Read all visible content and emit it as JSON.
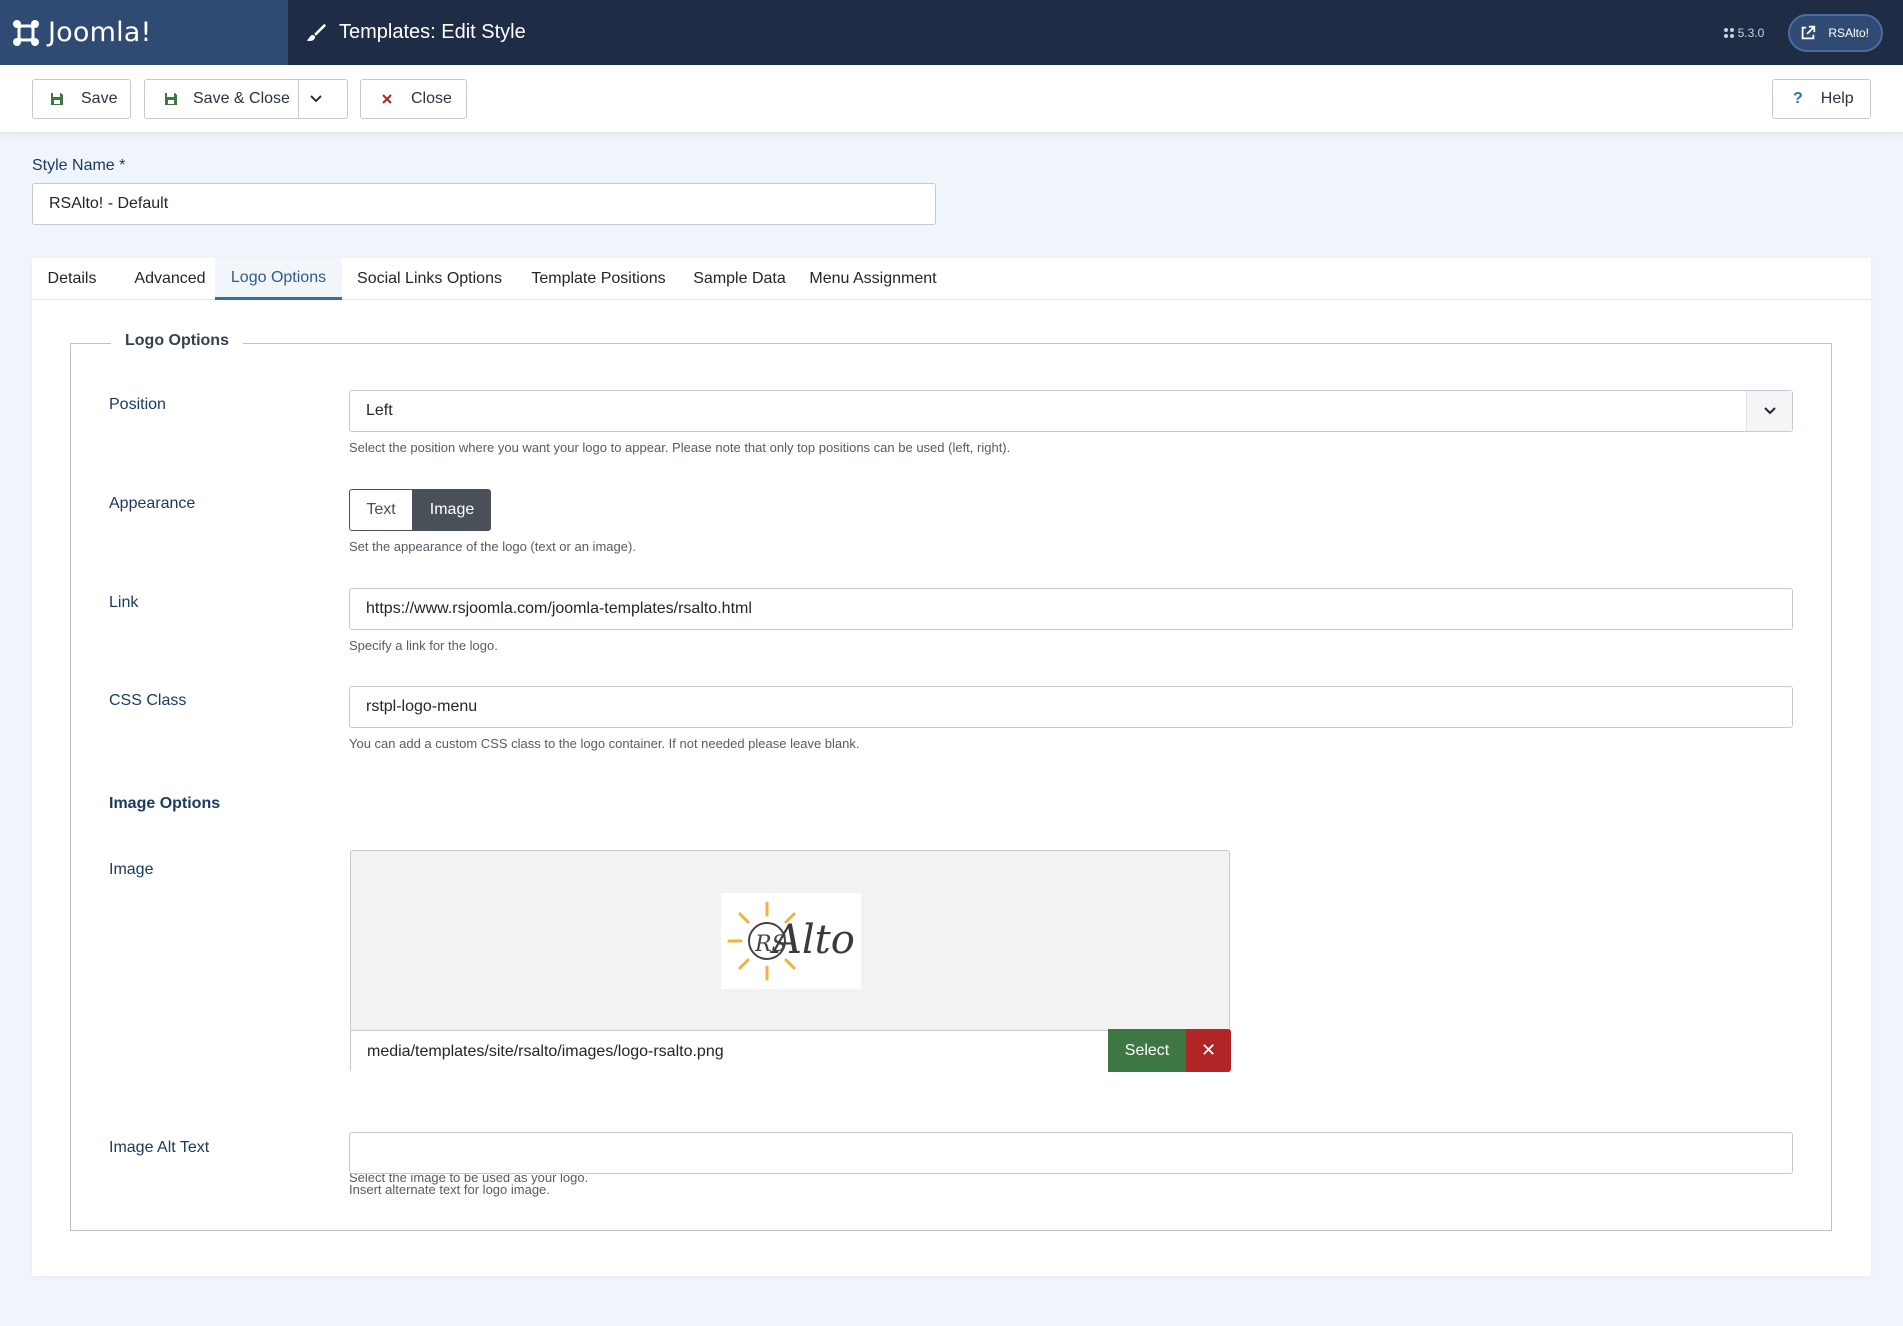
{
  "header": {
    "brand": "Joomla!",
    "title": "Templates: Edit Style",
    "version": "5.3.0",
    "site_name": "RSAlto!"
  },
  "toolbar": {
    "save_label": "Save",
    "save_close_label": "Save & Close",
    "close_label": "Close",
    "help_label": "Help",
    "help_glyph": "?"
  },
  "style_name": {
    "label": "Style Name *",
    "value": "RSAlto! - Default"
  },
  "tabs": [
    {
      "label": "Details"
    },
    {
      "label": "Advanced"
    },
    {
      "label": "Logo Options",
      "active": true
    },
    {
      "label": "Social Links Options"
    },
    {
      "label": "Template Positions"
    },
    {
      "label": "Sample Data"
    },
    {
      "label": "Menu Assignment"
    }
  ],
  "logo_options": {
    "legend": "Logo Options",
    "position": {
      "label": "Position",
      "value": "Left",
      "hint": "Select the position where you want your logo to appear. Please note that only top positions can be used (left, right)."
    },
    "appearance": {
      "label": "Appearance",
      "options": [
        "Text",
        "Image"
      ],
      "selected": "Image",
      "hint": "Set the appearance of the logo (text or an image)."
    },
    "link": {
      "label": "Link",
      "value": "https://www.rsjoomla.com/joomla-templates/rsalto.html",
      "hint": "Specify a link for the logo."
    },
    "css_class": {
      "label": "CSS Class",
      "value": "rstpl-logo-menu",
      "hint": "You can add a custom CSS class to the logo container. If not needed please leave blank."
    },
    "image_options_heading": "Image Options",
    "image": {
      "label": "Image",
      "path": "media/templates/site/rsalto/images/logo-rsalto.png",
      "select_label": "Select",
      "clear_glyph": "✕",
      "hint": "Select the image to be used as your logo.",
      "logo_text": "Alto",
      "logo_prefix": "RS"
    },
    "alt_text": {
      "label": "Image Alt Text",
      "value": "",
      "hint": "Insert alternate text for logo image."
    }
  },
  "colors": {
    "header_bg": "#1e2d45",
    "brand_bg": "#2f4a73",
    "accent": "#2f6fb0",
    "select_btn": "#3f7744",
    "clear_btn": "#b02626",
    "toggle_active": "#495057"
  }
}
